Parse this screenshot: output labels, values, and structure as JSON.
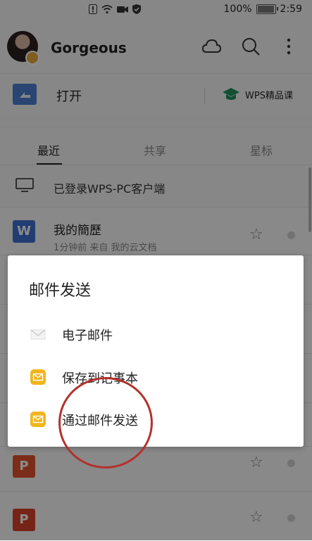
{
  "status_bar": {
    "battery": "100%",
    "time": "2:59"
  },
  "header": {
    "username": "Gorgeous"
  },
  "open_row": {
    "open_label": "打开",
    "course_label": "WPS精品课"
  },
  "tabs": [
    {
      "label": "最近"
    },
    {
      "label": "共享"
    },
    {
      "label": "星标"
    }
  ],
  "pc_row": {
    "label": "已登录WPS-PC客户端"
  },
  "files": [
    {
      "name": "我的簡歷",
      "meta": "1分钟前    来自 我的云文档",
      "icon_letter": "W",
      "icon_color": "#3f6fcf"
    },
    {
      "name": "",
      "meta": "",
      "icon_letter": "P",
      "icon_color": "#e0532f"
    },
    {
      "name": "",
      "meta": "",
      "icon_letter": "P",
      "icon_color": "#d8432b"
    }
  ],
  "dialog": {
    "title": "邮件发送",
    "options": [
      {
        "label": "电子邮件",
        "icon": "gmail-icon"
      },
      {
        "label": "保存到记事本",
        "icon": "mail-app-icon"
      },
      {
        "label": "通过邮件发送",
        "icon": "mail-app-icon"
      }
    ]
  },
  "colors": {
    "annotation": "#b3312d",
    "mail_icon": "#f2b51f"
  }
}
